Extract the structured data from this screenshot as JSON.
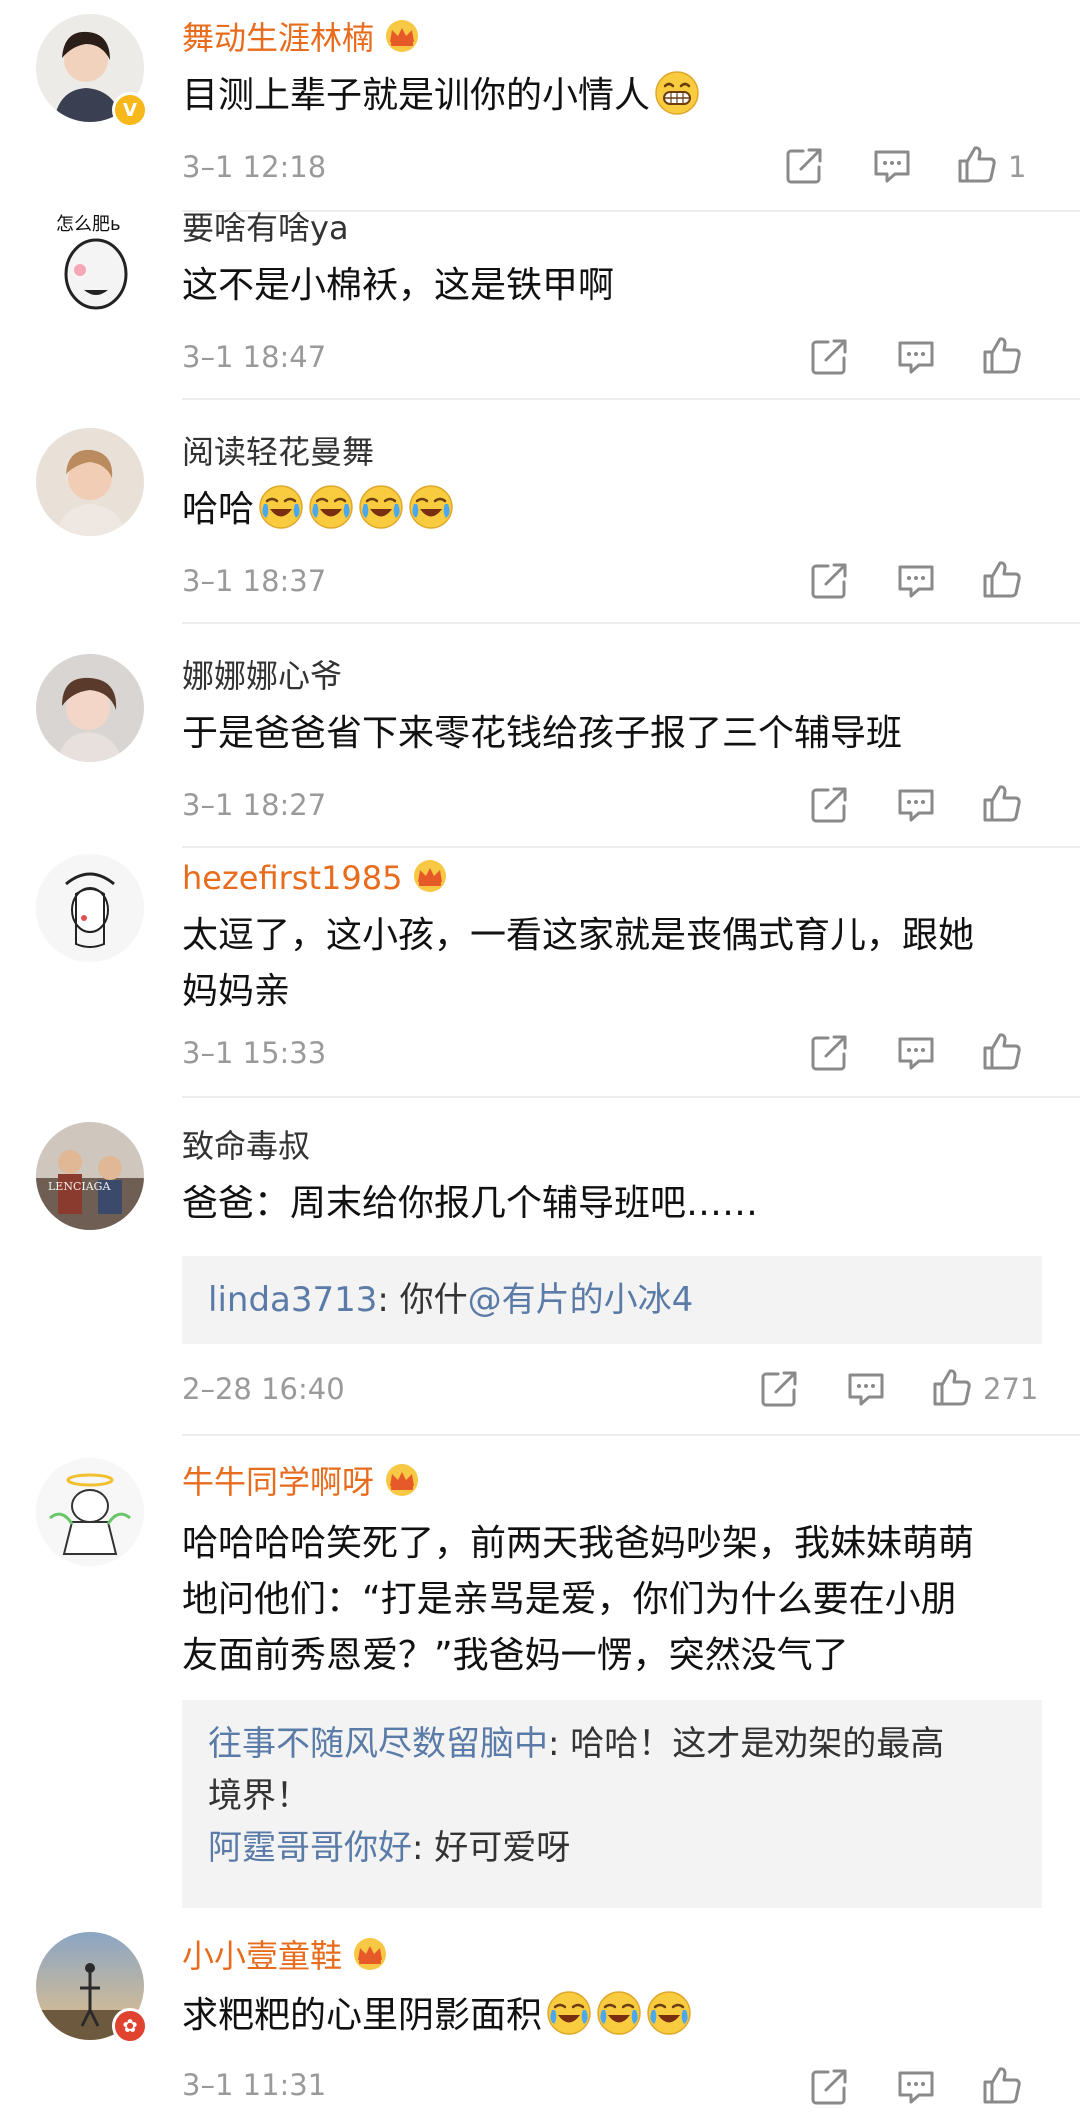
{
  "comments": [
    {
      "user": "舞动生涯林楠",
      "text": "目测上辈子就是训你的小情人",
      "time": "3–1 12:18",
      "likes": "1"
    },
    {
      "user": "要啥有啥ya",
      "text": "这不是小棉袄，这是铁甲啊",
      "time": "3–1 18:47"
    },
    {
      "user": "阅读轻花曼舞",
      "text": "哈哈",
      "time": "3–1 18:37"
    },
    {
      "user": "娜娜娜心爷",
      "text": "于是爸爸省下来零花钱给孩子报了三个辅导班",
      "time": "3–1 18:27"
    },
    {
      "user": "hezefirst1985",
      "text_line1": "太逗了，这小孩，一看这家就是丧偶式育儿，跟她",
      "text_line2": "妈妈亲",
      "time": "3–1 15:33"
    },
    {
      "user": "致命毒叔",
      "text": "爸爸：周末给你报几个辅导班吧……",
      "reply": {
        "user": "linda3713",
        "sep": ": ",
        "text_pre": "你什",
        "mention": "@有片的小冰4"
      },
      "time": "2–28 16:40",
      "likes": "271"
    },
    {
      "user": "牛牛同学啊呀",
      "text_line1": "哈哈哈哈笑死了，前两天我爸妈吵架，我妹妹萌萌",
      "text_line2": "地问他们：“打是亲骂是爱，你们为什么要在小朋",
      "text_line3": "友面前秀恩爱？”我爸妈一愣，突然没气了",
      "replies": [
        {
          "user": "往事不随风尽数留脑中",
          "sep": ": ",
          "text_line1": "哈哈！这才是劝架的最高",
          "text_line2": "境界！"
        },
        {
          "user": "阿霆哥哥你好",
          "sep": ": ",
          "text": "好可爱呀"
        }
      ]
    },
    {
      "user": "小小壹童鞋",
      "text": "求粑粑的心里阴影面积",
      "time": "3–1 11:31"
    }
  ],
  "icons": {
    "share": "share-icon",
    "reply": "comment-icon",
    "like": "thumbs-up-icon",
    "crown": "crown-badge-icon",
    "verified": "verified-badge-icon",
    "laugh_cry": "laugh-cry-emoji",
    "grin": "grin-emoji"
  },
  "colors": {
    "vip_name": "#e86c1d",
    "reply_user": "#5a7ba7",
    "meta": "#9a9a9a",
    "text": "#111111"
  }
}
